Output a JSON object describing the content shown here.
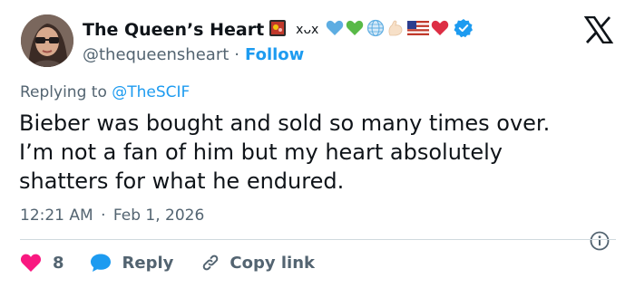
{
  "author": {
    "display_name": "The Queen’s Heart",
    "handle": "@thequeensheart",
    "separator": "·",
    "follow_label": "Follow",
    "name_emojis": [
      "🎴",
      "ⅹᴗⅹ",
      "💙",
      "💚",
      "🌐",
      "💪🏻",
      "🇺🇸",
      "❤️"
    ],
    "verified": true,
    "verified_color": "#1d9bf0"
  },
  "platform_logo": "x-logo-icon",
  "reply_context": {
    "prefix": "Replying to",
    "mention": "@TheSCIF"
  },
  "tweet": {
    "text": "Bieber was bought and sold so many times over.\nI’m not a fan of him but my heart absolutely\nshatters for what he endured.",
    "time": "12:21 AM",
    "date_separator": "·",
    "date": "Feb 1, 2026"
  },
  "actions": {
    "like_count": "8",
    "reply_label": "Reply",
    "copy_link_label": "Copy link"
  },
  "colors": {
    "accent": "#1d9bf0",
    "like": "#f91880",
    "text": "#0f1419",
    "muted": "#536471",
    "divider": "#cfd9de"
  }
}
